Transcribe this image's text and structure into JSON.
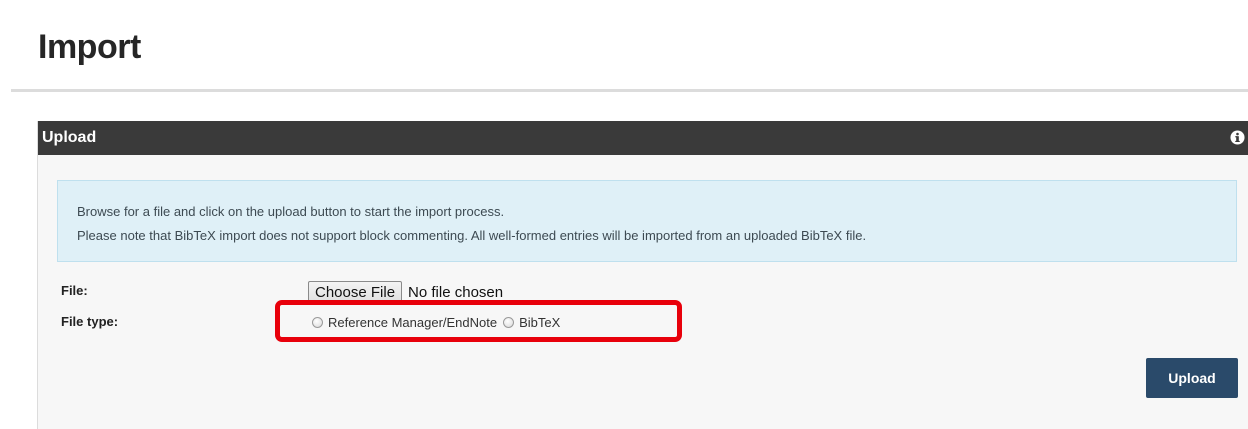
{
  "page": {
    "title": "Import"
  },
  "panel": {
    "title": "Upload",
    "info_icon": "info-circle-icon",
    "notice": {
      "line1": "Browse for a file and click on the upload button to start the import process.",
      "line2": "Please note that BibTeX import does not support block commenting. All well-formed entries will be imported from an uploaded BibTeX file."
    },
    "file_field": {
      "label": "File:",
      "button_label": "Choose File",
      "status": "No file chosen"
    },
    "file_type_field": {
      "label": "File type:",
      "options": [
        {
          "label": "Reference Manager/EndNote",
          "selected": false
        },
        {
          "label": "BibTeX",
          "selected": false
        }
      ]
    },
    "upload_button": "Upload"
  },
  "colors": {
    "header_bg": "#3a3a3a",
    "notice_bg": "#dff0f7",
    "upload_button_bg": "#2a4a6a",
    "highlight": "#e8000b"
  }
}
